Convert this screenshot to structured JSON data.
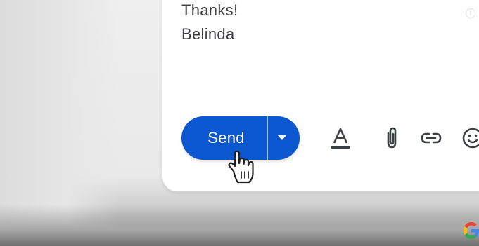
{
  "message": {
    "lines": [
      "Thanks!",
      "Belinda"
    ]
  },
  "compose_toolbar": {
    "send_label": "Send",
    "send_options_icon": "caret-down-icon",
    "formatting_icon": "text-format-icon",
    "attach_icon": "paperclip-icon",
    "link_icon": "link-icon",
    "emoji_icon": "emoji-icon"
  },
  "info_glyph": "i",
  "cursor": "hand-pointer-icon",
  "branding": "google-logo-icon",
  "colors": {
    "send_button": "#0b57d0",
    "send_text": "#ffffff",
    "body_text": "#3c4043",
    "icon_color": "#3c4043"
  }
}
